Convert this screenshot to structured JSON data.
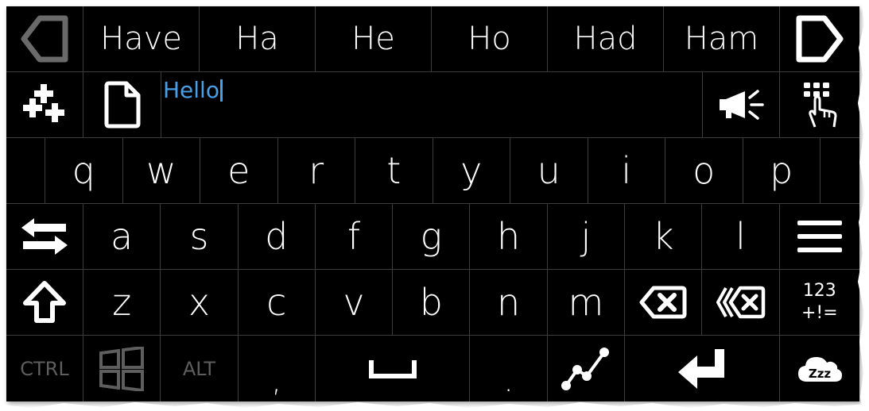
{
  "suggestions": [
    "Have",
    "Ha",
    "He",
    "Ho",
    "Had",
    "Ham"
  ],
  "input": {
    "text": "Hello"
  },
  "row_qwerty": [
    "q",
    "w",
    "e",
    "r",
    "t",
    "y",
    "u",
    "i",
    "o",
    "p"
  ],
  "row_asdf": [
    "a",
    "s",
    "d",
    "f",
    "g",
    "h",
    "j",
    "k",
    "l"
  ],
  "row_zxcv": [
    "z",
    "x",
    "c",
    "v",
    "b",
    "n",
    "m"
  ],
  "keys": {
    "symbols_line1": "123",
    "symbols_line2": "+!=",
    "ctrl": "CTRL",
    "alt": "ALT",
    "comma": ",",
    "period": "."
  },
  "icons": {
    "nav_left": "triangle-left-icon",
    "nav_right": "triangle-right-icon",
    "sparkle": "plus-sparkle-icon",
    "document": "document-icon",
    "speak": "megaphone-icon",
    "keypad": "keypad-touch-icon",
    "swap": "swap-arrows-icon",
    "menu": "hamburger-icon",
    "shift": "shift-arrow-icon",
    "backspace": "backspace-icon",
    "delete_word": "delete-word-icon",
    "windows": "windows-icon",
    "space": "space-bar-icon",
    "swipe": "swipe-path-icon",
    "enter": "enter-arrow-icon",
    "sleep": "cloud-zzz-icon"
  },
  "colors": {
    "background": "#000000",
    "text": "#ffffff",
    "typed_text": "#4aa0e6",
    "disabled": "#5e5e5e",
    "grid": "#3c3c3c"
  }
}
